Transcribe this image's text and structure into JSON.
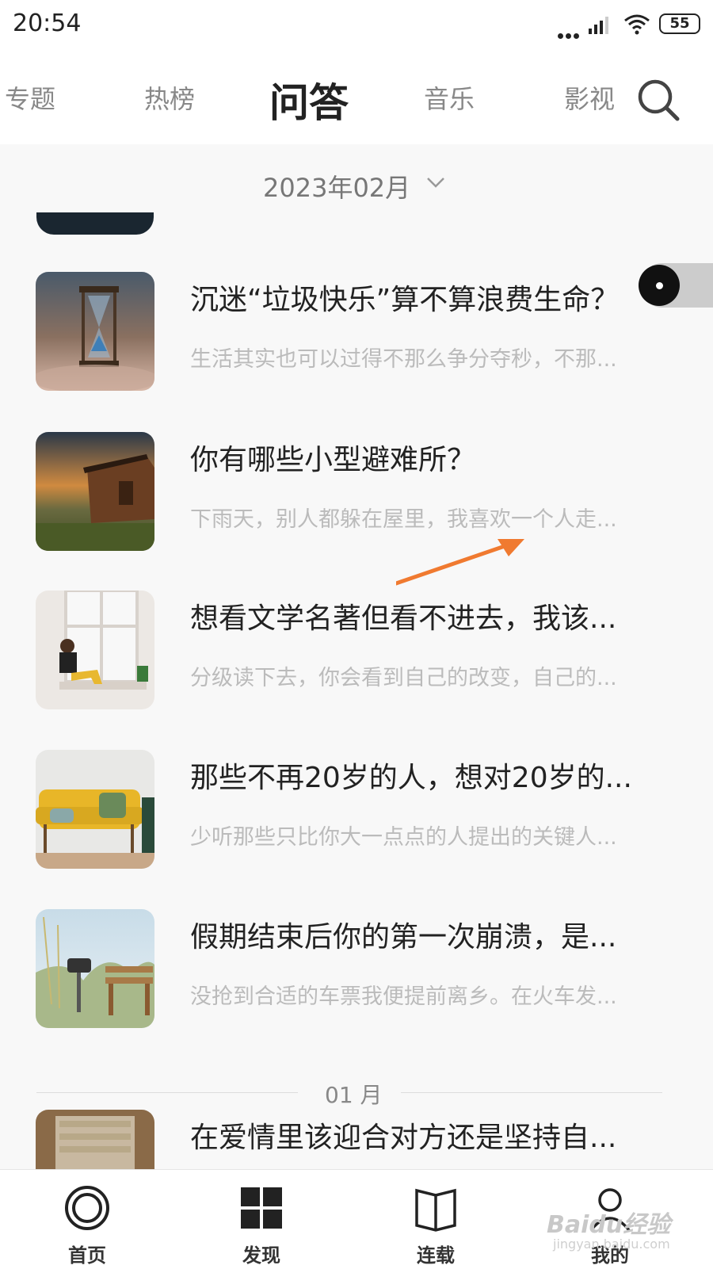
{
  "status": {
    "time": "20:54",
    "battery": "55"
  },
  "tabs": [
    {
      "label": "专题"
    },
    {
      "label": "热榜"
    },
    {
      "label": "问答"
    },
    {
      "label": "音乐"
    },
    {
      "label": "影视"
    }
  ],
  "month_selector": {
    "label": "2023年02月"
  },
  "items": [
    {
      "title": "沉迷“垃圾快乐”算不算浪费生命？",
      "summary": "生活其实也可以过得不那么争分夺秒，不那..."
    },
    {
      "title": "你有哪些小型避难所？",
      "summary": "下雨天，别人都躲在屋里，我喜欢一个人走..."
    },
    {
      "title": "想看文学名著但看不进去，我该...",
      "summary": "分级读下去，你会看到自己的改变，自己的..."
    },
    {
      "title": "那些不再20岁的人，想对20岁的...",
      "summary": "少听那些只比你大一点点的人提出的关键人..."
    },
    {
      "title": "假期结束后你的第一次崩溃，是...",
      "summary": "没抢到合适的车票我便提前离乡。在火车发..."
    },
    {
      "title": "在爱情里该迎合对方还是坚持自...",
      "summary": ""
    }
  ],
  "month_divider": "01 月",
  "bottom_nav": [
    {
      "label": "首页",
      "icon": "home-ring-icon"
    },
    {
      "label": "发现",
      "icon": "grid-icon"
    },
    {
      "label": "连载",
      "icon": "book-icon"
    },
    {
      "label": "我的",
      "icon": "user-icon"
    }
  ],
  "watermark": {
    "brand": "Baidu经验",
    "url": "jingyan.baidu.com"
  },
  "colors": {
    "accent_arrow": "#f07a30",
    "text_dark": "#222222",
    "text_muted": "#bbbbbb"
  }
}
